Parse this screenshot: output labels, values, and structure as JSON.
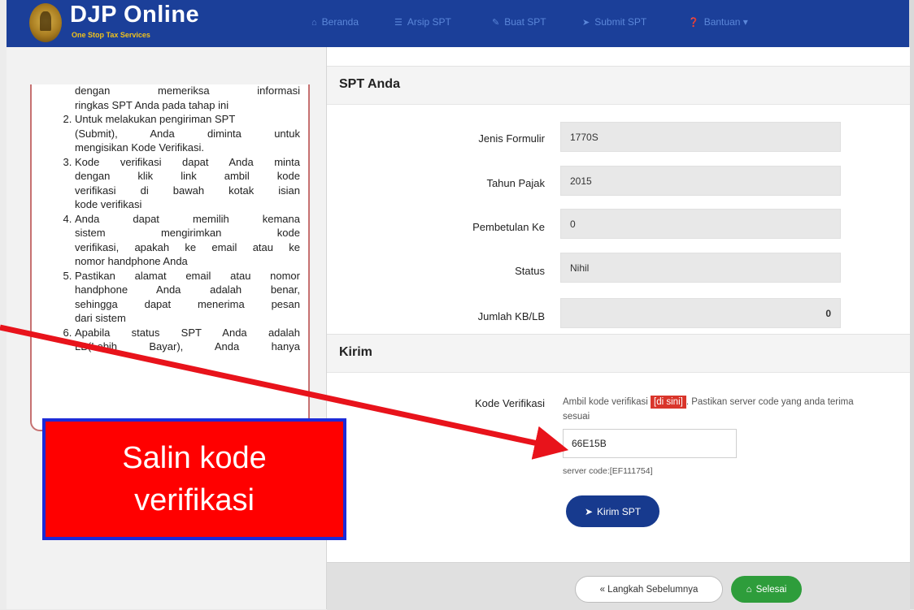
{
  "navbar": {
    "brand_title": "DJP Online",
    "brand_subtitle": "One Stop Tax Services",
    "items": [
      {
        "icon": "home-icon",
        "label": "Beranda"
      },
      {
        "icon": "list-icon",
        "label": "Arsip SPT"
      },
      {
        "icon": "edit-icon",
        "label": "Buat SPT"
      },
      {
        "icon": "send-icon",
        "label": "Submit SPT"
      },
      {
        "icon": "help-icon",
        "label": "Bantuan"
      }
    ]
  },
  "sidebar": {
    "intro_lines": [
      "dengan memeriksa informasi",
      "ringkas SPT Anda pada tahap ini"
    ],
    "steps": [
      {
        "lines": [
          "Untuk melakukan pengiriman SPT",
          "(Submit), Anda diminta untuk",
          "mengisikan Kode Verifikasi."
        ]
      },
      {
        "lines": [
          "Kode verifikasi dapat Anda minta",
          "dengan klik link ambil kode",
          "verifikasi di bawah kotak isian",
          "kode verifikasi"
        ]
      },
      {
        "lines": [
          "Anda dapat memilih kemana",
          "sistem mengirimkan kode",
          "verifikasi, apakah ke email atau ke",
          "nomor handphone Anda"
        ]
      },
      {
        "lines": [
          "Pastikan alamat email atau nomor",
          "handphone Anda adalah benar,",
          "sehingga dapat menerima pesan",
          "dari sistem"
        ]
      },
      {
        "lines": [
          "Apabila status SPT Anda adalah",
          "LB(Lebih Bayar), Anda hanya"
        ]
      }
    ]
  },
  "spt": {
    "section_title": "SPT Anda",
    "fields": [
      {
        "label": "Jenis Formulir",
        "value": "1770S",
        "align": "left"
      },
      {
        "label": "Tahun Pajak",
        "value": "2015",
        "align": "left"
      },
      {
        "label": "Pembetulan Ke",
        "value": "0",
        "align": "left"
      },
      {
        "label": "Status",
        "value": "Nihil",
        "align": "left"
      },
      {
        "label": "Jumlah KB/LB",
        "value": "0",
        "align": "right"
      }
    ]
  },
  "kirim": {
    "section_title": "Kirim",
    "code_label": "Kode Verifikasi",
    "instruction_before": "Ambil kode verifikasi",
    "link_label": "[di sini]",
    "instruction_after": ". Pastikan server code yang anda terima sesuai",
    "code_value": "66E15B",
    "server_code": "server code:[EF111754]",
    "submit_label": "Kirim SPT"
  },
  "footer": {
    "prev_label": "« Langkah Sebelumnya",
    "done_label": "Selesai"
  },
  "callout": {
    "line1": "Salin kode",
    "line2": "verifikasi",
    "fill_color": "#ff0000",
    "border_color": "#1d2bd8",
    "arrow_color": "#e8131b"
  }
}
